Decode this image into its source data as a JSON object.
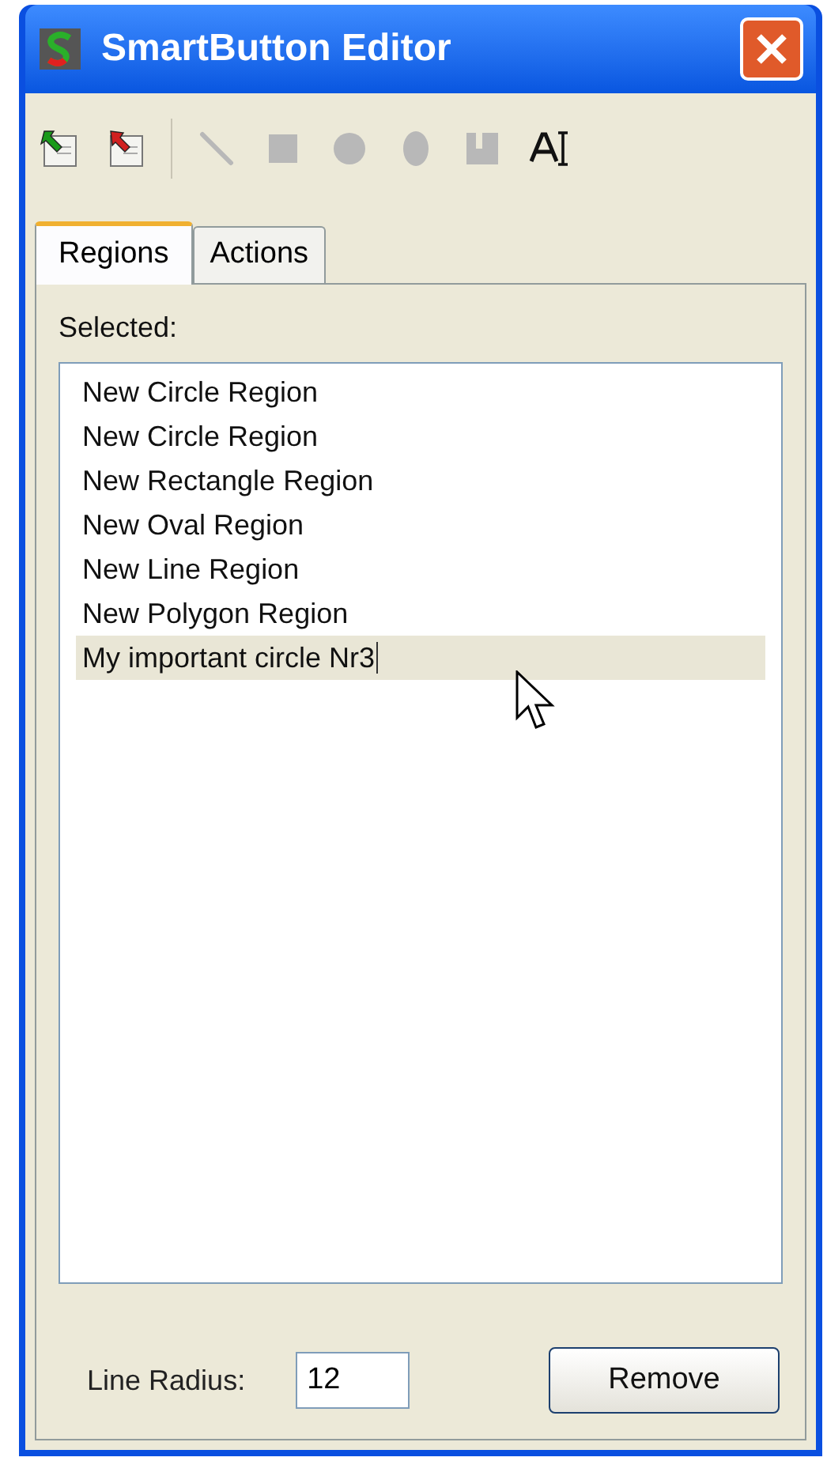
{
  "window": {
    "title": "SmartButton Editor"
  },
  "toolbar": [
    {
      "kind": "import",
      "disabled": false
    },
    {
      "kind": "export",
      "disabled": false
    },
    {
      "kind": "line",
      "disabled": true
    },
    {
      "kind": "rectangle",
      "disabled": true
    },
    {
      "kind": "circle",
      "disabled": true
    },
    {
      "kind": "oval",
      "disabled": true
    },
    {
      "kind": "polygon",
      "disabled": true
    },
    {
      "kind": "text",
      "disabled": false
    }
  ],
  "tabs": [
    {
      "label": "Regions",
      "selected": true
    },
    {
      "label": "Actions",
      "selected": false
    }
  ],
  "list_label": "Selected:",
  "regions": [
    {
      "label": "New Circle Region",
      "selected": false,
      "editing": false
    },
    {
      "label": "New Circle Region",
      "selected": false,
      "editing": false
    },
    {
      "label": "New Rectangle Region",
      "selected": false,
      "editing": false
    },
    {
      "label": "New Oval Region",
      "selected": false,
      "editing": false
    },
    {
      "label": "New Line Region",
      "selected": false,
      "editing": false
    },
    {
      "label": "New Polygon Region",
      "selected": false,
      "editing": false
    },
    {
      "label": "My important circle Nr3",
      "selected": true,
      "editing": true
    }
  ],
  "line_radius": {
    "label": "Line Radius:",
    "value": "12"
  },
  "remove_button": "Remove"
}
